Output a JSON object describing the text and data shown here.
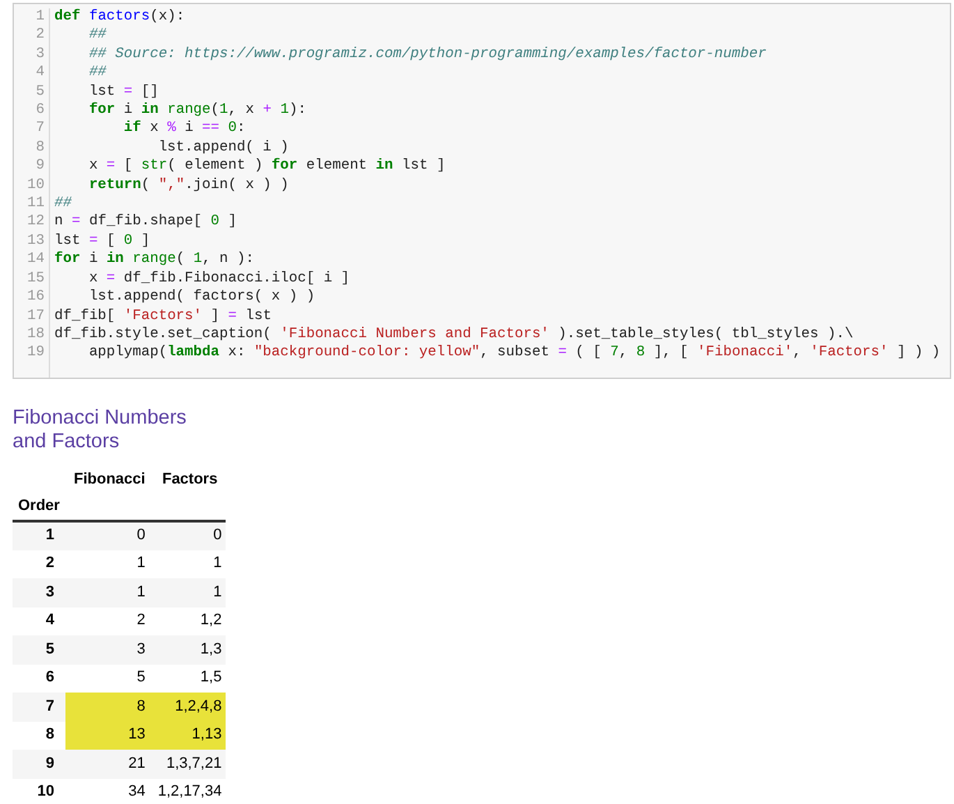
{
  "code": {
    "lines": [
      {
        "number": "1",
        "tokens": [
          {
            "kind": "kw",
            "text": "def"
          },
          {
            "kind": "fn",
            "text": " factors"
          },
          {
            "kind": "t",
            "text": "(x):"
          }
        ]
      },
      {
        "number": "2",
        "tokens": [
          {
            "kind": "c",
            "text": "    ##"
          }
        ]
      },
      {
        "number": "3",
        "tokens": [
          {
            "kind": "c",
            "text": "    ## Source: https://www.programiz.com/python-programming/examples/factor-number"
          }
        ]
      },
      {
        "number": "4",
        "tokens": [
          {
            "kind": "c",
            "text": "    ##"
          }
        ]
      },
      {
        "number": "5",
        "tokens": [
          {
            "kind": "t",
            "text": "    lst "
          },
          {
            "kind": "op",
            "text": "="
          },
          {
            "kind": "t",
            "text": " []"
          }
        ]
      },
      {
        "number": "6",
        "tokens": [
          {
            "kind": "kw",
            "text": "    for"
          },
          {
            "kind": "t",
            "text": " i "
          },
          {
            "kind": "kw",
            "text": "in"
          },
          {
            "kind": "b",
            "text": " range"
          },
          {
            "kind": "t",
            "text": "("
          },
          {
            "kind": "n",
            "text": "1"
          },
          {
            "kind": "t",
            "text": ", x "
          },
          {
            "kind": "op",
            "text": "+"
          },
          {
            "kind": "n",
            "text": " 1"
          },
          {
            "kind": "t",
            "text": "):"
          }
        ]
      },
      {
        "number": "7",
        "tokens": [
          {
            "kind": "kw",
            "text": "        if"
          },
          {
            "kind": "t",
            "text": " x "
          },
          {
            "kind": "op",
            "text": "%"
          },
          {
            "kind": "t",
            "text": " i "
          },
          {
            "kind": "op",
            "text": "=="
          },
          {
            "kind": "n",
            "text": " 0"
          },
          {
            "kind": "t",
            "text": ":"
          }
        ]
      },
      {
        "number": "8",
        "tokens": [
          {
            "kind": "t",
            "text": "            lst.append( i )"
          }
        ]
      },
      {
        "number": "9",
        "tokens": [
          {
            "kind": "t",
            "text": "    x "
          },
          {
            "kind": "op",
            "text": "="
          },
          {
            "kind": "t",
            "text": " [ "
          },
          {
            "kind": "b",
            "text": "str"
          },
          {
            "kind": "t",
            "text": "( element ) "
          },
          {
            "kind": "kw",
            "text": "for"
          },
          {
            "kind": "t",
            "text": " element "
          },
          {
            "kind": "kw",
            "text": "in"
          },
          {
            "kind": "t",
            "text": " lst ]"
          }
        ]
      },
      {
        "number": "10",
        "tokens": [
          {
            "kind": "kw",
            "text": "    return"
          },
          {
            "kind": "t",
            "text": "( "
          },
          {
            "kind": "s",
            "text": "\",\""
          },
          {
            "kind": "t",
            "text": ".join( x ) )"
          }
        ]
      },
      {
        "number": "11",
        "tokens": [
          {
            "kind": "c",
            "text": "##"
          }
        ]
      },
      {
        "number": "12",
        "tokens": [
          {
            "kind": "t",
            "text": "n "
          },
          {
            "kind": "op",
            "text": "="
          },
          {
            "kind": "t",
            "text": " df_fib.shape[ "
          },
          {
            "kind": "n",
            "text": "0"
          },
          {
            "kind": "t",
            "text": " ]"
          }
        ]
      },
      {
        "number": "13",
        "tokens": [
          {
            "kind": "t",
            "text": "lst "
          },
          {
            "kind": "op",
            "text": "="
          },
          {
            "kind": "t",
            "text": " [ "
          },
          {
            "kind": "n",
            "text": "0"
          },
          {
            "kind": "t",
            "text": " ]"
          }
        ]
      },
      {
        "number": "14",
        "tokens": [
          {
            "kind": "kw",
            "text": "for"
          },
          {
            "kind": "t",
            "text": " i "
          },
          {
            "kind": "kw",
            "text": "in"
          },
          {
            "kind": "b",
            "text": " range"
          },
          {
            "kind": "t",
            "text": "( "
          },
          {
            "kind": "n",
            "text": "1"
          },
          {
            "kind": "t",
            "text": ", n ):"
          }
        ]
      },
      {
        "number": "15",
        "tokens": [
          {
            "kind": "t",
            "text": "    x "
          },
          {
            "kind": "op",
            "text": "="
          },
          {
            "kind": "t",
            "text": " df_fib.Fibonacci.iloc[ i ]"
          }
        ]
      },
      {
        "number": "16",
        "tokens": [
          {
            "kind": "t",
            "text": "    lst.append( factors( x ) )"
          }
        ]
      },
      {
        "number": "17",
        "tokens": [
          {
            "kind": "t",
            "text": "df_fib[ "
          },
          {
            "kind": "s",
            "text": "'Factors'"
          },
          {
            "kind": "t",
            "text": " ] "
          },
          {
            "kind": "op",
            "text": "="
          },
          {
            "kind": "t",
            "text": " lst"
          }
        ]
      },
      {
        "number": "18",
        "tokens": [
          {
            "kind": "t",
            "text": "df_fib.style.set_caption( "
          },
          {
            "kind": "s",
            "text": "'Fibonacci Numbers and Factors'"
          },
          {
            "kind": "t",
            "text": " ).set_table_styles( tbl_styles ).\\"
          }
        ]
      },
      {
        "number": "19",
        "tokens": [
          {
            "kind": "t",
            "text": "    applymap("
          },
          {
            "kind": "kw",
            "text": "lambda"
          },
          {
            "kind": "t",
            "text": " x: "
          },
          {
            "kind": "s",
            "text": "\"background-color: yellow\""
          },
          {
            "kind": "t",
            "text": ", subset "
          },
          {
            "kind": "op",
            "text": "="
          },
          {
            "kind": "t",
            "text": " ( [ "
          },
          {
            "kind": "n",
            "text": "7"
          },
          {
            "kind": "t",
            "text": ", "
          },
          {
            "kind": "n",
            "text": "8"
          },
          {
            "kind": "t",
            "text": " ], [ "
          },
          {
            "kind": "s",
            "text": "'Fibonacci'"
          },
          {
            "kind": "t",
            "text": ", "
          },
          {
            "kind": "s",
            "text": "'Factors'"
          },
          {
            "kind": "t",
            "text": " ] ) )"
          }
        ]
      }
    ]
  },
  "table": {
    "caption_lines": [
      "Fibonacci Numbers",
      "and Factors"
    ],
    "columns": [
      "Fibonacci",
      "Factors"
    ],
    "index_name": "Order",
    "rows": [
      {
        "order": "1",
        "fibonacci": "0",
        "factors": "0",
        "highlighted": false
      },
      {
        "order": "2",
        "fibonacci": "1",
        "factors": "1",
        "highlighted": false
      },
      {
        "order": "3",
        "fibonacci": "1",
        "factors": "1",
        "highlighted": false
      },
      {
        "order": "4",
        "fibonacci": "2",
        "factors": "1,2",
        "highlighted": false
      },
      {
        "order": "5",
        "fibonacci": "3",
        "factors": "1,3",
        "highlighted": false
      },
      {
        "order": "6",
        "fibonacci": "5",
        "factors": "1,5",
        "highlighted": false
      },
      {
        "order": "7",
        "fibonacci": "8",
        "factors": "1,2,4,8",
        "highlighted": true
      },
      {
        "order": "8",
        "fibonacci": "13",
        "factors": "1,13",
        "highlighted": true
      },
      {
        "order": "9",
        "fibonacci": "21",
        "factors": "1,3,7,21",
        "highlighted": false
      },
      {
        "order": "10",
        "fibonacci": "34",
        "factors": "1,2,17,34",
        "highlighted": false
      }
    ]
  }
}
